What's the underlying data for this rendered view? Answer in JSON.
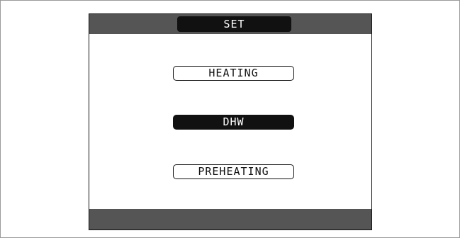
{
  "header": {
    "title": "SET"
  },
  "menu": {
    "items": [
      {
        "label": "HEATING",
        "selected": false
      },
      {
        "label": "DHW",
        "selected": true
      },
      {
        "label": "PREHEATING",
        "selected": false
      }
    ]
  },
  "colors": {
    "bar": "#555555",
    "selected_background": "#111111",
    "selected_text": "#ffffff",
    "text": "#111111"
  }
}
